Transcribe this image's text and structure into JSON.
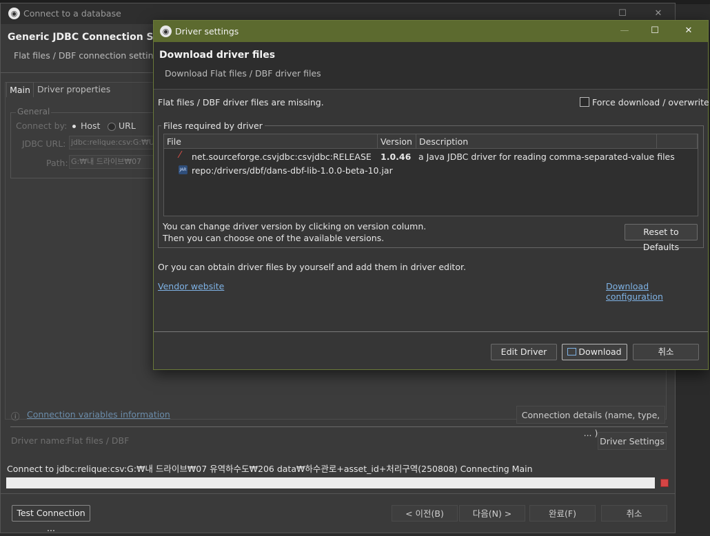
{
  "background_window": {
    "title": "Connect to a database",
    "header_title": "Generic JDBC Connection Setti",
    "header_subtitle": "Flat files / DBF connection settings",
    "tabs": [
      {
        "label": "Main"
      },
      {
        "label": "Driver properties"
      }
    ],
    "general": {
      "legend": "General",
      "connect_by_label": "Connect by:",
      "host_label": "Host",
      "url_label": "URL",
      "jdbc_url_label": "JDBC URL:",
      "jdbc_url_value": "jdbc:relique:csv:G:₩U",
      "path_label": "Path:",
      "path_value": "G:₩내 드라이브₩07"
    },
    "connection_variables_link": "Connection variables information",
    "connection_details_button": "Connection details (name, type, ... )",
    "driver_name_label": "Driver name:",
    "driver_name_value": "Flat files / DBF",
    "driver_settings_button": "Driver Settings",
    "status_text": "Connect to jdbc:relique:csv:G:₩내 드라이브₩07 유역하수도₩206 data₩하수관로+asset_id+처리구역(250808) Connecting Main",
    "test_connection_button": "Test Connection ...",
    "back_button": "< 이전(B)",
    "next_button": "다음(N) >",
    "finish_button": "완료(F)",
    "cancel_button": "취소"
  },
  "driver_dialog": {
    "title": "Driver settings",
    "header_title": "Download driver files",
    "header_subtitle": "Download Flat files / DBF driver files",
    "missing_message": "Flat files / DBF driver files are missing.",
    "force_download_label": "Force download / overwrite",
    "files_group_label": "Files required by driver",
    "columns": [
      "File",
      "Version",
      "Description"
    ],
    "files": [
      {
        "file": "net.sourceforge.csvjdbc:csvjdbc:RELEASE",
        "version": "1.0.46",
        "description": "a Java JDBC driver for reading comma-separated-value files"
      },
      {
        "file": "repo:/drivers/dbf/dans-dbf-lib-1.0.0-beta-10.jar",
        "version": "",
        "description": ""
      }
    ],
    "version_hint_1": "You can change driver version by clicking on version column.",
    "version_hint_2": "Then you can choose one of the available versions.",
    "reset_button": "Reset to Defaults",
    "obtain_message": "Or you can obtain driver files by yourself and add them in driver editor.",
    "vendor_link": "Vendor website",
    "download_config_link": "Download configuration",
    "edit_driver_button": "Edit Driver",
    "download_button": "Download",
    "cancel_button": "취소"
  },
  "colors": {
    "title_bar_accent": "#5c6a2f",
    "link": "#7fb3e6",
    "stop": "#d64545"
  }
}
